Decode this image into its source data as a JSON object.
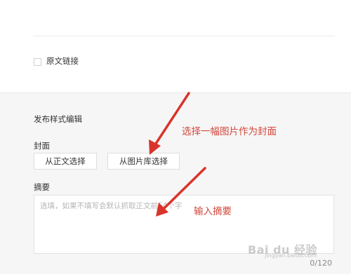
{
  "source_link": {
    "label": "原文链接",
    "checked": false
  },
  "publish_style": {
    "section_title": "发布样式编辑",
    "cover": {
      "label": "封面",
      "buttons": {
        "from_text": "从正文选择",
        "from_library": "从图片库选择"
      }
    },
    "summary": {
      "label": "摘要",
      "placeholder": "选填，如果不填写会默认抓取正文前54个字",
      "counter": "0/120"
    }
  },
  "annotations": {
    "cover_hint": "选择一幅图片作为封面",
    "summary_hint": "输入摘要"
  },
  "watermark": {
    "brand": "Bai du 经验",
    "sub": "jingyan.baidu.com"
  },
  "colors": {
    "annotation": "#d2473c",
    "panel_bg": "#f6f6f6"
  }
}
